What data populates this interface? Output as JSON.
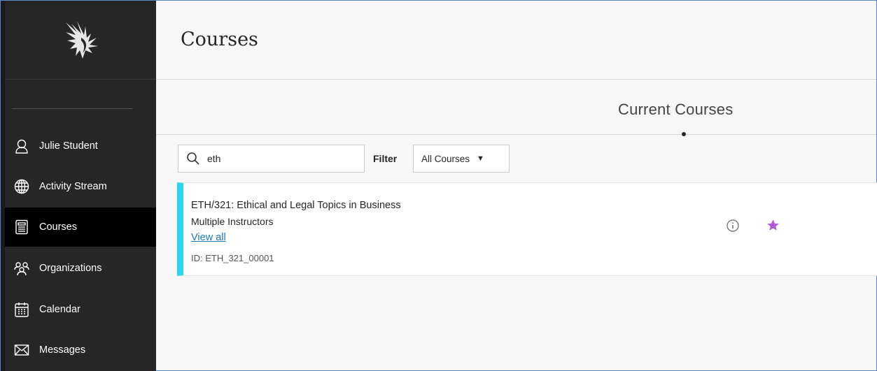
{
  "sidebar": {
    "items": [
      {
        "label": "Julie Student",
        "icon": "user-icon"
      },
      {
        "label": "Activity Stream",
        "icon": "globe-icon"
      },
      {
        "label": "Courses",
        "icon": "courses-icon",
        "active": true
      },
      {
        "label": "Organizations",
        "icon": "organizations-icon"
      },
      {
        "label": "Calendar",
        "icon": "calendar-icon"
      },
      {
        "label": "Messages",
        "icon": "envelope-icon"
      }
    ]
  },
  "header": {
    "title": "Courses"
  },
  "tabs": {
    "current": "Current Courses"
  },
  "search": {
    "value": "eth",
    "icon": "search-icon"
  },
  "filter": {
    "label": "Filter",
    "selected": "All Courses"
  },
  "course": {
    "title": "ETH/321: Ethical and Legal Topics in Business",
    "instructors": "Multiple Instructors",
    "view_all": "View all",
    "id": "ID: ETH_321_00001",
    "accent_color": "#2ad4f2",
    "favorite_color": "#b259d6"
  }
}
